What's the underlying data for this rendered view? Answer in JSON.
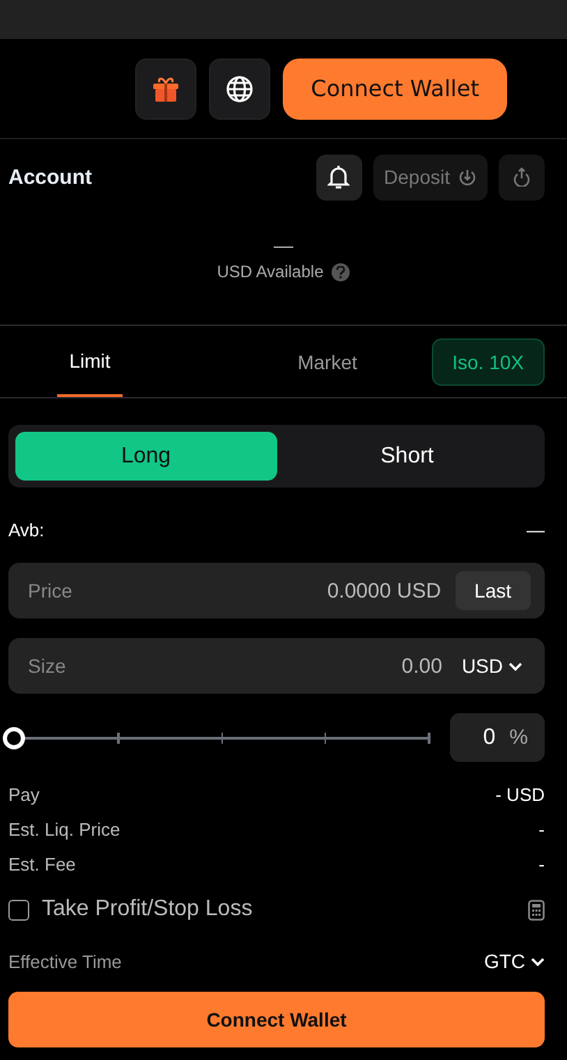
{
  "header": {
    "connect_label": "Connect Wallet"
  },
  "account": {
    "title": "Account",
    "deposit_label": "Deposit",
    "balance": "—",
    "balance_label": "USD Available"
  },
  "tabs": [
    {
      "label": "Limit",
      "selected": true
    },
    {
      "label": "Market",
      "selected": false
    }
  ],
  "margin_mode": "Iso. 10X",
  "sides": [
    {
      "label": "Long",
      "selected": true
    },
    {
      "label": "Short",
      "selected": false
    }
  ],
  "available": {
    "label": "Avb:",
    "value": "—"
  },
  "price": {
    "placeholder": "Price",
    "value": "0.0000 USD",
    "button": "Last"
  },
  "size": {
    "placeholder": "Size",
    "value": "0.00",
    "unit": "USD"
  },
  "slider": {
    "level": 0,
    "percent": "0",
    "unit": "%"
  },
  "summary": [
    {
      "label": "Pay",
      "value": "- USD"
    },
    {
      "label": "Est. Liq. Price",
      "value": "-"
    },
    {
      "label": "Est. Fee",
      "value": "-"
    }
  ],
  "tpsl": {
    "label": "Take Profit/Stop Loss",
    "checked": false
  },
  "effective_time": {
    "label": "Effective Time",
    "value": "GTC"
  },
  "submit_label": "Connect Wallet"
}
